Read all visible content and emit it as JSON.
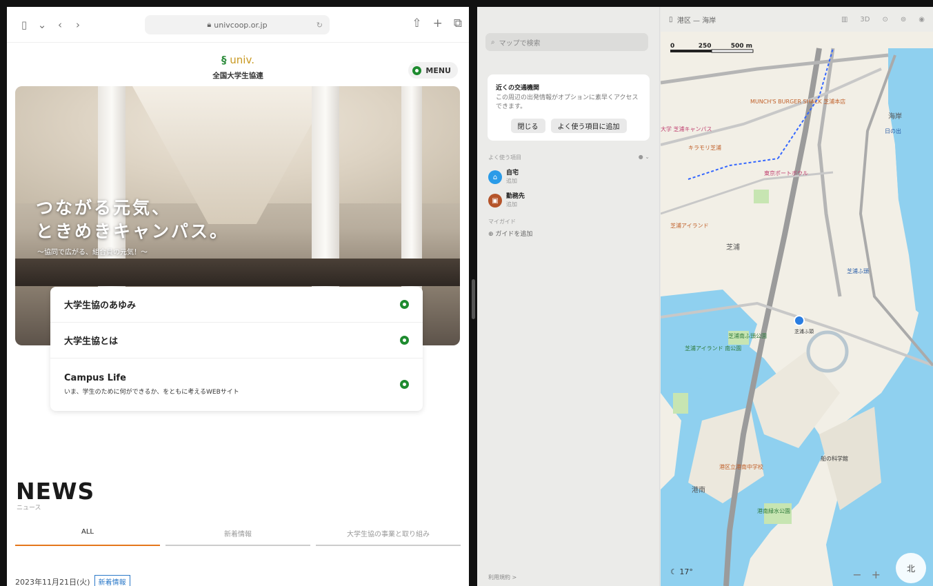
{
  "safari": {
    "url": "univcoop.or.jp",
    "brand_logo": "univ.",
    "brand_name": "全国大学生協連",
    "menu_label": "MENU",
    "hero": {
      "headline_line1": "つながる元気、",
      "headline_line2": "ときめきキャンパス。",
      "subline": "〜協同で広がる、組合員の元気！〜"
    },
    "links": [
      {
        "title": "大学生協のあゆみ"
      },
      {
        "title": "大学生協とは"
      },
      {
        "title": "Campus Life",
        "desc": "いま、学生のために何ができるか、をともに考えるWEBサイト"
      }
    ],
    "news_title": "NEWS",
    "news_sub": "ニュース",
    "news_tabs": [
      "ALL",
      "新着情報",
      "大学生協の事業と取り組み"
    ],
    "news_date": "2023年11月21日(火)",
    "news_tag": "新着情報"
  },
  "maps": {
    "search_placeholder": "マップで検索",
    "transit_card": {
      "title": "近くの交通機関",
      "desc": "この周辺の出発情報がオプションに素早くアクセスできます。",
      "close_label": "閉じる",
      "add_label": "よく使う項目に追加"
    },
    "favorites_header": "よく使う項目",
    "favorites": [
      {
        "name": "自宅",
        "sub": "追加",
        "color": "#2a9be8"
      },
      {
        "name": "勤務先",
        "sub": "追加",
        "color": "#b5542a"
      }
    ],
    "my_guides": "マイガイド",
    "add_guide": "ガイドを追加",
    "footer": "利用規約 >",
    "map_toolbar_title": "港区 — 海岸",
    "scale": {
      "zero": "0",
      "mid": "250",
      "end": "500 m"
    },
    "weather": "17°",
    "compass": "北",
    "labels": {
      "kaigan": "海岸",
      "shibaura": "芝浦",
      "kounan": "港南",
      "hinode": "日の出",
      "shibaura_futo": "芝浦ふ頭",
      "ship_hall": "船の科学館",
      "munch": "MUNCH'S BURGER SHACK 芝浦本店",
      "campus": "大学 芝浦キャンパス",
      "kiramora": "キラモリ芝浦",
      "port_bowl": "東京ポートボウル",
      "kotsu_park": "芝浦南ふ頭公園",
      "island_park": "芝浦アイランド 南公園",
      "kounan_park": "港南緑水公園",
      "kounan_school": "港区立港南中学校",
      "shibaura_island": "芝浦アイランド",
      "blue_dot": "芝浦ふ頭"
    }
  },
  "colors": {
    "coop_green": "#1e8b2f",
    "news_accent": "#e4761b",
    "map_water": "#8fd0ef",
    "map_park": "#c7e5b2"
  }
}
